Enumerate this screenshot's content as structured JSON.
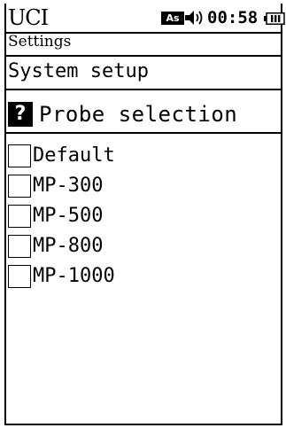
{
  "status_bar": {
    "app_name": "UCI",
    "badge": "As",
    "speaker_icon": "speaker-icon",
    "time": "00:58",
    "battery_icon": "battery-icon"
  },
  "breadcrumb": "Settings",
  "section_title": "System setup",
  "page": {
    "help_icon": "?",
    "heading": "Probe selection"
  },
  "options": [
    {
      "label": "Default",
      "checked": false
    },
    {
      "label": "MP-300",
      "checked": false
    },
    {
      "label": "MP-500",
      "checked": false
    },
    {
      "label": "MP-800",
      "checked": false
    },
    {
      "label": "MP-1000",
      "checked": false
    }
  ]
}
